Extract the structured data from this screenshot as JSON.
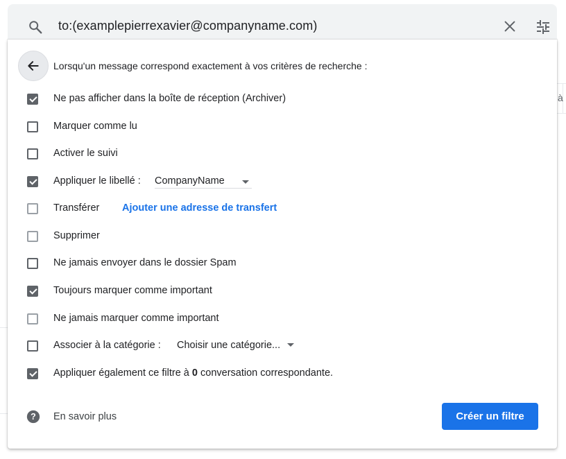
{
  "search": {
    "query": "to:(examplepierrexavier@companyname.com)"
  },
  "background": {
    "edge_char": "à"
  },
  "panel": {
    "header": "Lorsqu'un message correspond exactement à vos critères de recherche :",
    "options": {
      "archive": {
        "label": "Ne pas afficher dans la boîte de réception (Archiver)",
        "checked": true
      },
      "mark_read": {
        "label": "Marquer comme lu",
        "checked": false
      },
      "star": {
        "label": "Activer le suivi",
        "checked": false
      },
      "apply_label": {
        "label": "Appliquer le libellé :",
        "checked": true,
        "value": "CompanyName"
      },
      "forward": {
        "label": "Transférer",
        "checked": false,
        "link": "Ajouter une adresse de transfert"
      },
      "delete": {
        "label": "Supprimer",
        "checked": false
      },
      "never_spam": {
        "label": "Ne jamais envoyer dans le dossier Spam",
        "checked": false
      },
      "always_important": {
        "label": "Toujours marquer comme important",
        "checked": true
      },
      "never_important": {
        "label": "Ne jamais marquer comme important",
        "checked": false
      },
      "category": {
        "label": "Associer à la catégorie :",
        "checked": false,
        "value": "Choisir une catégorie..."
      },
      "apply_existing": {
        "label_before": "Appliquer également ce filtre à",
        "count": "0",
        "label_after": "conversation correspondante.",
        "checked": true
      }
    },
    "help_link": "En savoir plus",
    "create_button": "Créer un filtre"
  },
  "colors": {
    "accent": "#1a73e8",
    "checkbox": "#5f6368",
    "searchbar_bg": "#f1f3f4"
  },
  "icons": [
    "search-icon",
    "close-icon",
    "tune-icon",
    "arrow-back-icon",
    "help-icon",
    "chevron-down-icon"
  ]
}
